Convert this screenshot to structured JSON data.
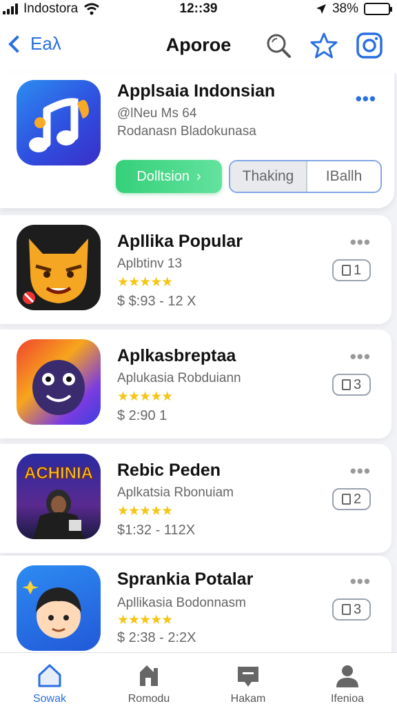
{
  "status_bar": {
    "carrier": "Indostora",
    "time": "12::39",
    "battery": "38%"
  },
  "nav": {
    "back_label": "Eaλ",
    "title": "Aporoe",
    "icons": [
      "search-icon",
      "star-icon",
      "instagram-icon"
    ]
  },
  "featured": {
    "name": "Applsaia Indonsian",
    "handle": "@lNeu Ms 64",
    "description": "Rodanasn Bladokunasa",
    "primary_button": "Dolltsion",
    "segment_left": "Thaking",
    "segment_right": "IBallh"
  },
  "apps": [
    {
      "name": "Apllika Popular",
      "subtitle": "Aplbtinv 13",
      "stars": "★★★★★",
      "price": "$ $:93 - 12 X",
      "badge": "1"
    },
    {
      "name": "Aplkasbreptaa",
      "subtitle": "Aplukasia Robduiann",
      "stars": "★★★★★",
      "price": "$ 2:90 1",
      "badge": "3"
    },
    {
      "name": "Rebic Peden",
      "subtitle": "Aplkatsia Rbonuiam",
      "stars": "★★★★★",
      "price": "$1:32 - 112X",
      "badge": "2"
    },
    {
      "name": "Sprankia Potalar",
      "subtitle": "Apllikasia Bodonnasm",
      "stars": "★★★★★",
      "price": "$ 2:38 - 2:2X",
      "badge": "3"
    }
  ],
  "tabs": [
    {
      "label": "Sowak",
      "icon": "home-icon",
      "active": true
    },
    {
      "label": "Romodu",
      "icon": "apps-icon",
      "active": false
    },
    {
      "label": "Hakam",
      "icon": "games-icon",
      "active": false
    },
    {
      "label": "Ifenioa",
      "icon": "profile-icon",
      "active": false
    }
  ],
  "colors": {
    "accent": "#2a6fe0",
    "install_green": "#35d07a",
    "star": "#f5c518"
  }
}
